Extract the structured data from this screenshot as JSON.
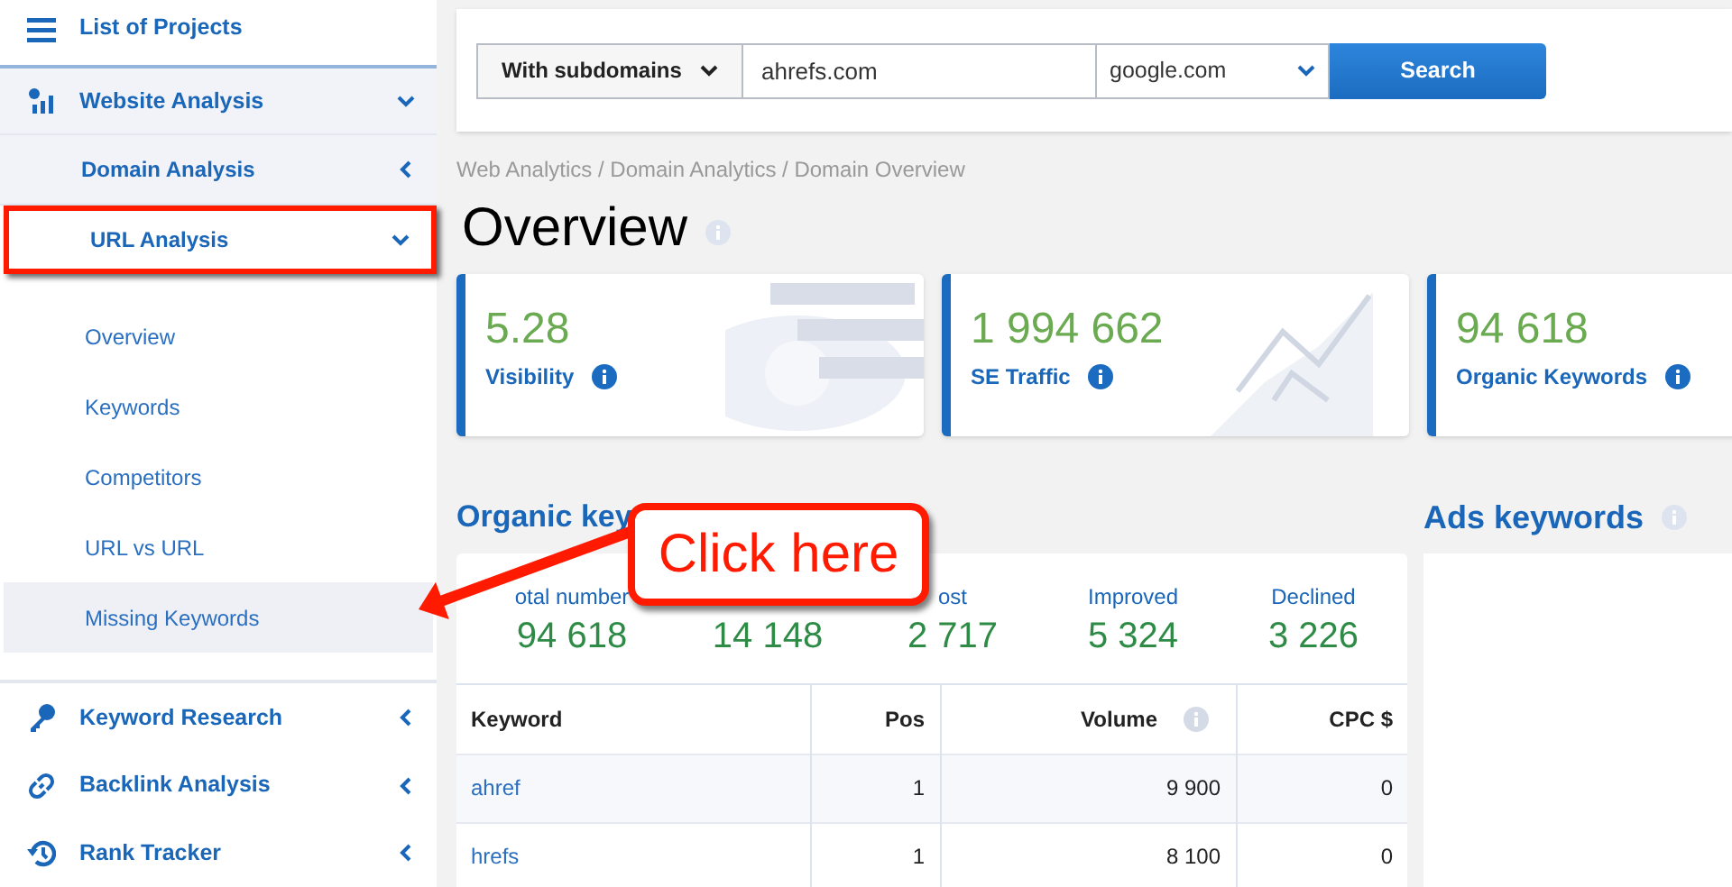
{
  "sidebar": {
    "items": [
      {
        "label": "List of Projects"
      },
      {
        "label": "Website Analysis",
        "expanded": true,
        "children": [
          {
            "label": "Domain Analysis",
            "expanded": false,
            "boxed": false
          },
          {
            "label": "URL Analysis",
            "expanded": true,
            "boxed": true,
            "children": [
              {
                "label": "Overview",
                "selected": false
              },
              {
                "label": "Keywords",
                "selected": false
              },
              {
                "label": "Competitors",
                "selected": false
              },
              {
                "label": "URL vs URL",
                "selected": false
              },
              {
                "label": "Missing Keywords",
                "selected": true
              }
            ]
          }
        ]
      },
      {
        "label": "Keyword Research",
        "expanded": false
      },
      {
        "label": "Backlink Analysis",
        "expanded": false
      },
      {
        "label": "Rank Tracker",
        "expanded": false
      }
    ]
  },
  "search": {
    "mode": "With subdomains",
    "domain": "ahrefs.com",
    "engine": "google.com",
    "button": "Search"
  },
  "breadcrumb": "Web Analytics / Domain Analytics / Domain Overview",
  "title": "Overview",
  "cards": [
    {
      "value": "5.28",
      "label": "Visibility",
      "kind": "eye"
    },
    {
      "value": "1 994 662",
      "label": "SE Traffic",
      "kind": "chart"
    },
    {
      "value": "94 618",
      "label": "Organic Keywords",
      "kind": "plain"
    }
  ],
  "organic": {
    "heading": "Organic key",
    "stats": [
      {
        "label": "otal number",
        "value": "94 618"
      },
      {
        "value": "14 148"
      },
      {
        "label": "ost",
        "value": "2 717"
      },
      {
        "label": "Improved",
        "value": "5 324"
      },
      {
        "label": "Declined",
        "value": "3 226"
      }
    ],
    "table": {
      "columns": [
        "Keyword",
        "Pos",
        "Volume",
        "CPC $"
      ],
      "rows": [
        [
          "ahref",
          "1",
          "9 900",
          "0"
        ],
        [
          "hrefs",
          "1",
          "8 100",
          "0"
        ]
      ]
    }
  },
  "ads": {
    "heading": "Ads keywords"
  },
  "callout": {
    "text": "Click here"
  }
}
